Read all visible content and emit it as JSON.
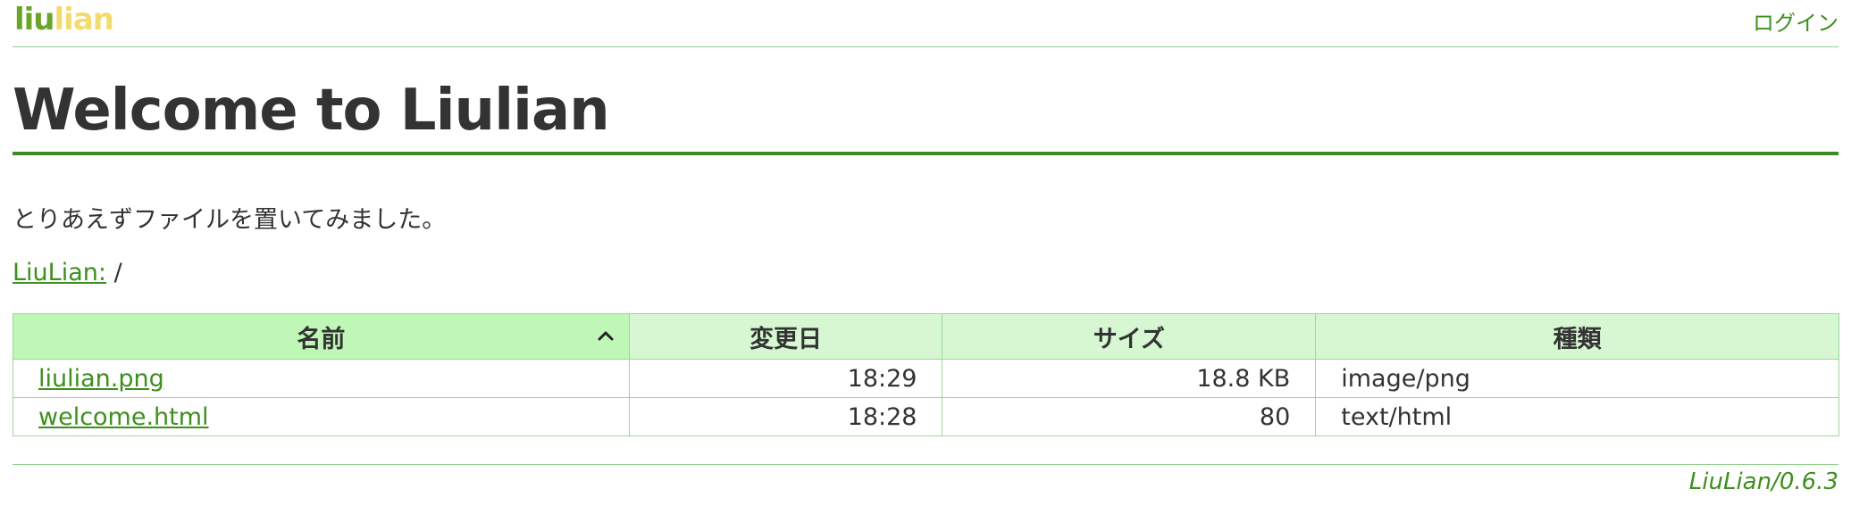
{
  "header": {
    "logo": {
      "part_a": "liu",
      "part_b": "lian"
    },
    "login_label": "ログイン"
  },
  "page": {
    "title": "Welcome to Liulian",
    "intro": "とりあえずファイルを置いてみました。"
  },
  "breadcrumb": {
    "root_label": "LiuLian:",
    "path": "/"
  },
  "table": {
    "columns": [
      "名前",
      "変更日",
      "サイズ",
      "種類"
    ],
    "sorted_column": "名前",
    "sort_direction": "ascending",
    "rows": [
      {
        "name": "liulian.png",
        "modified": "18:29",
        "size": "18.8 KB",
        "type": "image/png"
      },
      {
        "name": "welcome.html",
        "modified": "18:28",
        "size": "80",
        "type": "text/html"
      }
    ]
  },
  "footer": {
    "version": "LiuLian/0.6.3"
  },
  "colors": {
    "accent": "#3d8f1e",
    "header_bg": "#d6f7d2",
    "sorted_header_bg": "#bff7b6",
    "border": "#9dd69a",
    "logo_green": "#6aa52a",
    "logo_yellow": "#f2dc72"
  },
  "icons": {
    "sort": "chevron-up-icon"
  }
}
